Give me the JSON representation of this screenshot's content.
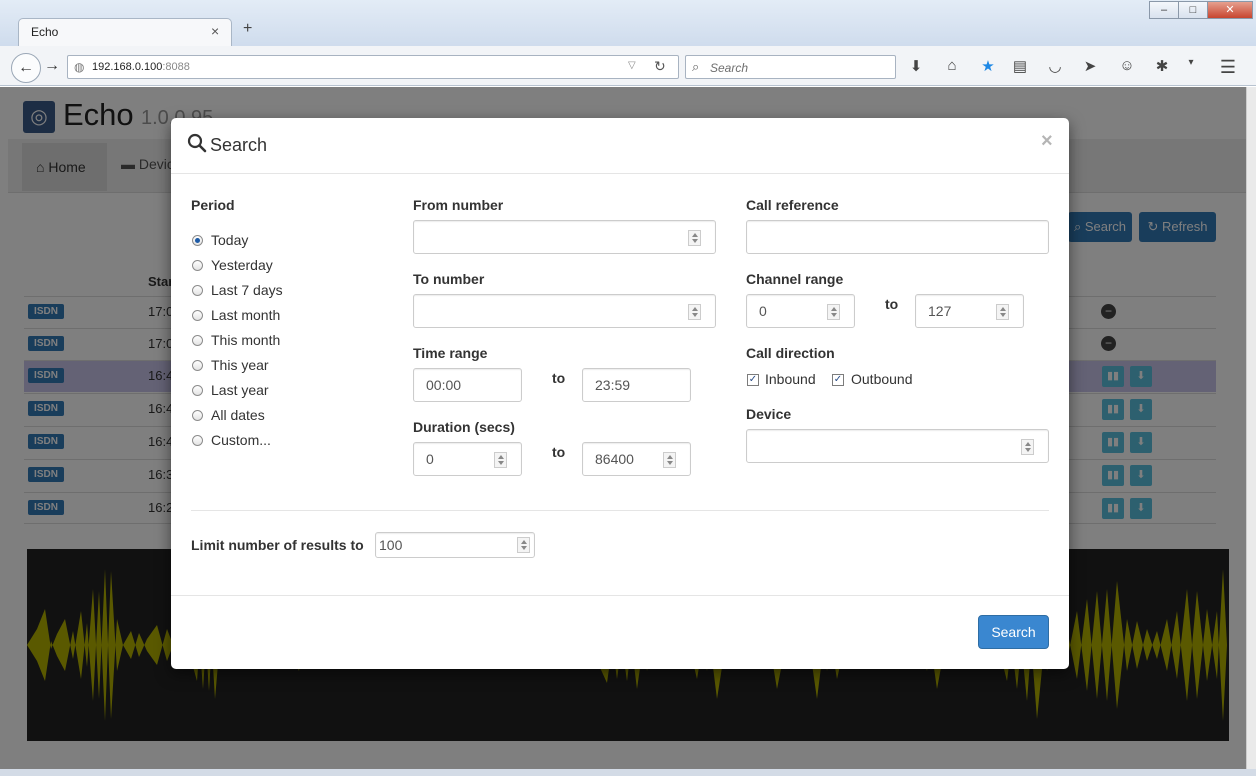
{
  "browser": {
    "tab_title": "Echo",
    "tab_close": "×",
    "new_tab": "+",
    "url_host": "192.168.0.100",
    "url_port": ":8088",
    "search_placeholder": "Search"
  },
  "app": {
    "title": "Echo",
    "version": "1.0.0.95",
    "tabs": [
      "Home",
      "Devices"
    ],
    "buttons": {
      "search": "Search",
      "refresh": "Refresh"
    },
    "column_start": "Start",
    "rows": [
      {
        "type": "ISDN",
        "time": "17:0"
      },
      {
        "type": "ISDN",
        "time": "17:0"
      },
      {
        "type": "ISDN",
        "time": "16:4"
      },
      {
        "type": "ISDN",
        "time": "16:4"
      },
      {
        "type": "ISDN",
        "time": "16:4"
      },
      {
        "type": "ISDN",
        "time": "16:3"
      },
      {
        "type": "ISDN",
        "time": "16:2"
      }
    ]
  },
  "modal": {
    "title": "Search",
    "close": "×",
    "period": {
      "label": "Period",
      "options": [
        "Today",
        "Yesterday",
        "Last 7 days",
        "Last month",
        "This month",
        "This year",
        "Last year",
        "All dates",
        "Custom..."
      ],
      "selected": "Today"
    },
    "from_number": {
      "label": "From number",
      "value": ""
    },
    "to_number": {
      "label": "To number",
      "value": ""
    },
    "time_range": {
      "label": "Time range",
      "from": "00:00",
      "to_label": "to",
      "to": "23:59"
    },
    "duration": {
      "label": "Duration (secs)",
      "from": "0",
      "to_label": "to",
      "to": "86400"
    },
    "call_reference": {
      "label": "Call reference",
      "value": ""
    },
    "channel_range": {
      "label": "Channel range",
      "from": "0",
      "to_label": "to",
      "to": "127"
    },
    "call_direction": {
      "label": "Call direction",
      "inbound": "Inbound",
      "outbound": "Outbound",
      "inbound_checked": true,
      "outbound_checked": true
    },
    "device": {
      "label": "Device",
      "value": ""
    },
    "limit": {
      "label": "Limit number of results to",
      "value": "100"
    },
    "submit": "Search"
  },
  "colors": {
    "primary": "#337ab7",
    "wave_fill": "#b5b300",
    "wave_bg": "#222222",
    "selected_row": "#c8c4ea"
  }
}
